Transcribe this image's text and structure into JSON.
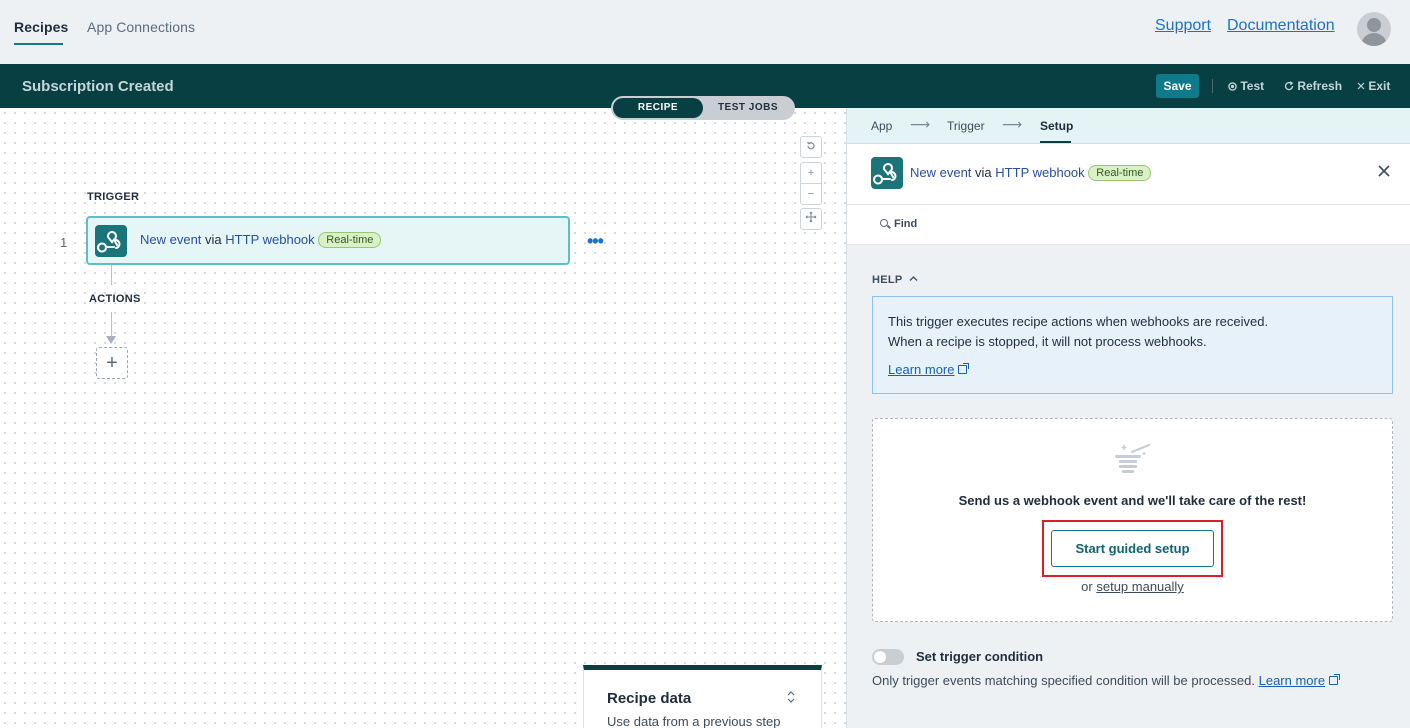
{
  "topnav": {
    "tabs": [
      "Recipes",
      "App Connections"
    ],
    "links": {
      "support": "Support",
      "documentation": "Documentation"
    }
  },
  "header": {
    "title": "Subscription Created",
    "save": "Save",
    "test": "Test",
    "refresh": "Refresh",
    "exit": "Exit",
    "test_icon": "record-icon",
    "refresh_icon": "refresh-icon",
    "exit_icon": "close-icon"
  },
  "canvas": {
    "toggle": {
      "recipe": "RECIPE",
      "test_jobs": "TEST JOBS"
    },
    "trigger_label": "TRIGGER",
    "actions_label": "ACTIONS",
    "step_number": "1",
    "step": {
      "event": "New event",
      "via": "via",
      "app": "HTTP webhook",
      "badge": "Real-time",
      "icon": "webhook-icon"
    },
    "recipe_data": {
      "title": "Recipe data",
      "subtitle": "Use data from a previous step"
    }
  },
  "panel": {
    "breadcrumbs": [
      "App",
      "Trigger",
      "Setup"
    ],
    "step": {
      "event": "New event",
      "via": "via",
      "app": "HTTP webhook",
      "badge": "Real-time"
    },
    "find": "Find",
    "help": {
      "label": "HELP",
      "line1": "This trigger executes recipe actions when webhooks are received.",
      "line2": "When a recipe is stopped, it will not process webhooks.",
      "learn_more": "Learn more"
    },
    "setup": {
      "message": "Send us a webhook event and we'll take care of the rest!",
      "button": "Start guided setup",
      "or": "or",
      "manual": "setup manually"
    },
    "condition": {
      "title": "Set trigger condition",
      "description": "Only trigger events matching specified condition will be processed.",
      "learn_more": "Learn more"
    }
  },
  "colors": {
    "brand_dark": "#073f42",
    "accent": "#0f7a8a",
    "link": "#1a73c8",
    "highlight": "#d9202a"
  }
}
